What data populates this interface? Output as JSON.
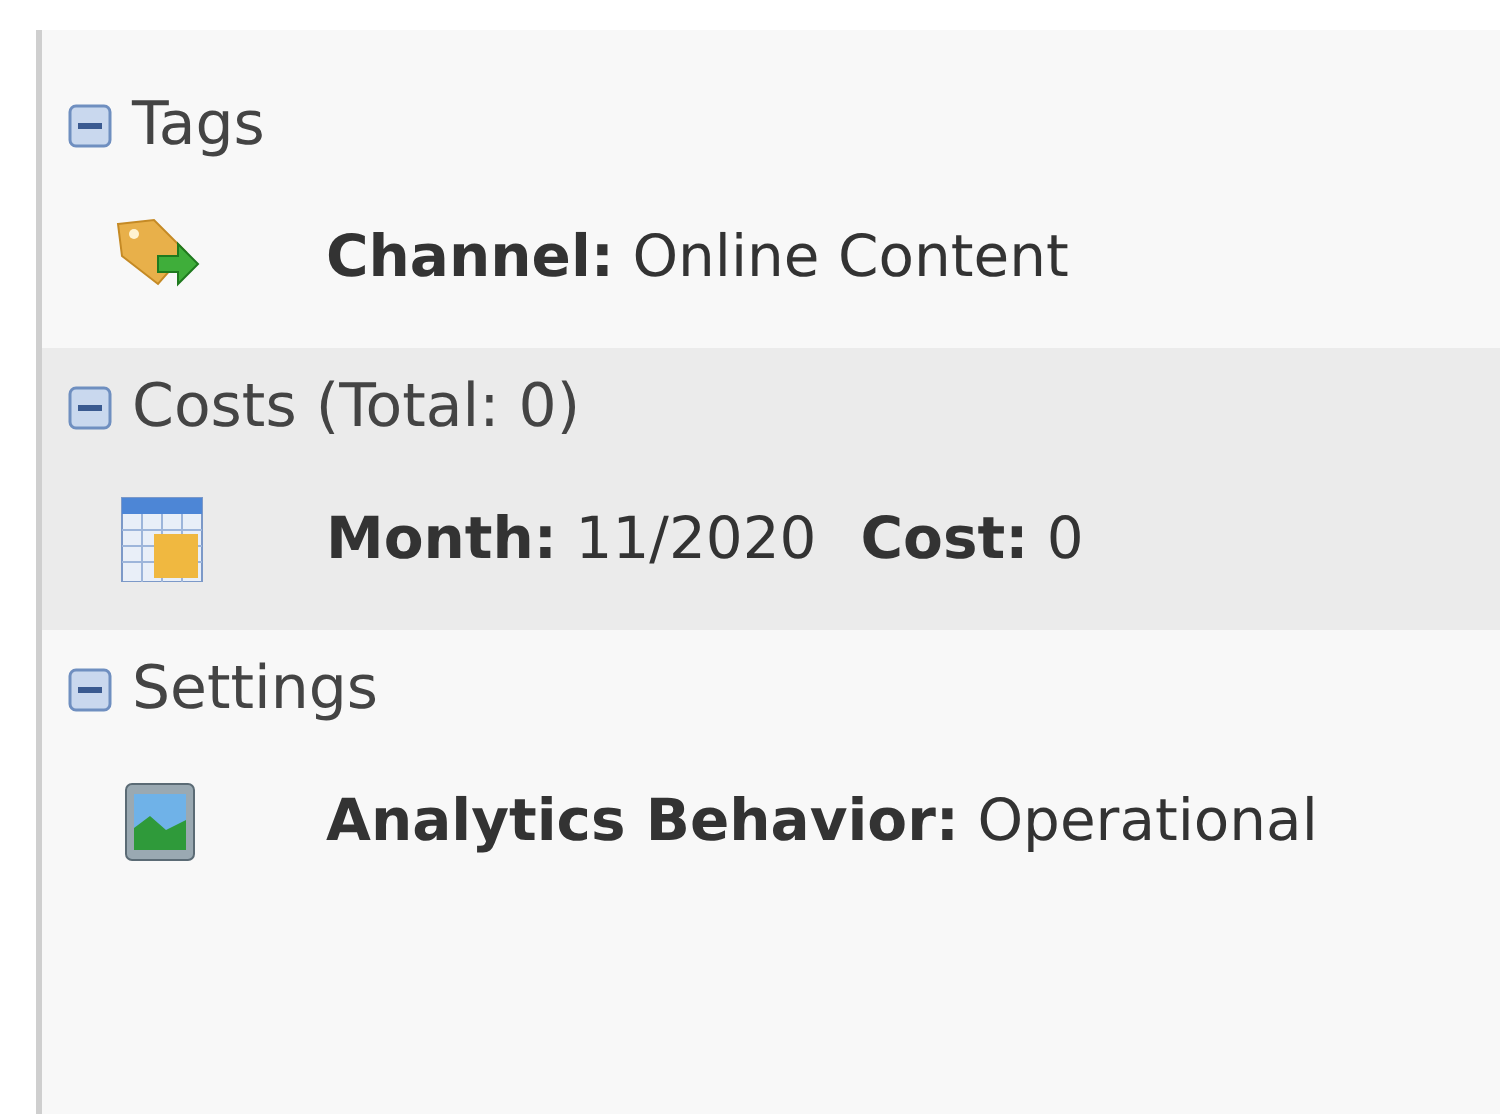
{
  "sections": [
    {
      "title": "Tags",
      "expanded": true,
      "selected": false,
      "items": [
        {
          "kind": "tag",
          "fields": [
            {
              "label": "Channel:",
              "value": "Online Content"
            }
          ]
        }
      ]
    },
    {
      "title": "Costs (Total: 0)",
      "expanded": true,
      "selected": true,
      "items": [
        {
          "kind": "calendar",
          "fields": [
            {
              "label": "Month:",
              "value": "11/2020"
            },
            {
              "label": "Cost:",
              "value": "0"
            }
          ]
        }
      ]
    },
    {
      "title": "Settings",
      "expanded": true,
      "selected": false,
      "items": [
        {
          "kind": "image",
          "fields": [
            {
              "label": "Analytics Behavior:",
              "value": "Operational"
            }
          ]
        }
      ]
    }
  ]
}
